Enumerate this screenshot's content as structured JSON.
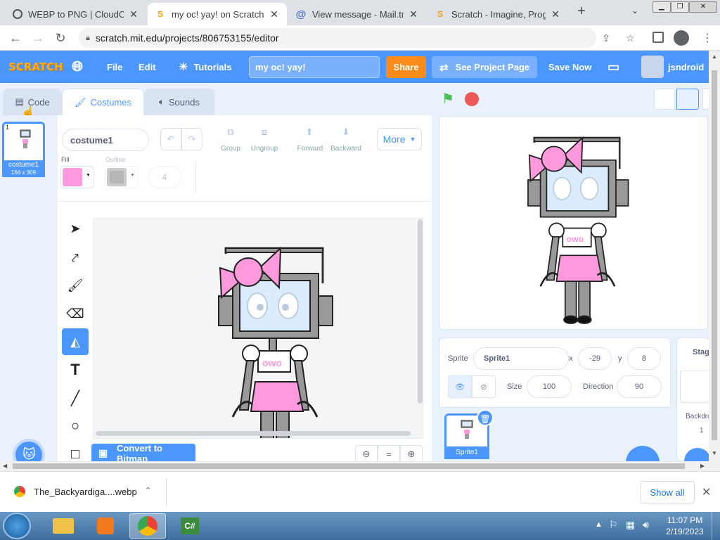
{
  "browser": {
    "tabs": [
      {
        "title": "WEBP to PNG | CloudCon",
        "icon": "cloudconvert-icon",
        "active": false
      },
      {
        "title": "my oc! yay! on Scratch",
        "icon": "scratch-icon",
        "active": true
      },
      {
        "title": "View message - Mail.tm",
        "icon": "mail-icon",
        "active": false
      },
      {
        "title": "Scratch - Imagine, Progra",
        "icon": "scratch-icon",
        "active": false
      }
    ],
    "new_tab": "+",
    "url": "scratch.mit.edu/projects/806753155/editor"
  },
  "menubar": {
    "logo": "SCRATCH",
    "file": "File",
    "edit": "Edit",
    "tutorials": "Tutorials",
    "project_title": "my oc! yay!",
    "share": "Share",
    "see_project": "See Project Page",
    "save_now": "Save Now",
    "username": "jsndroid"
  },
  "editor_tabs": {
    "code": "Code",
    "costumes": "Costumes",
    "sounds": "Sounds"
  },
  "costume_list": [
    {
      "index": "1",
      "name": "costume1",
      "size": "166 x 309"
    }
  ],
  "paint_editor": {
    "costume_name": "costume1",
    "group": "Group",
    "ungroup": "Ungroup",
    "forward": "Forward",
    "backward": "Backward",
    "more": "More",
    "fill_label": "Fill",
    "outline_label": "Outline",
    "outline_width": "4",
    "fill_color": "#ff99dd",
    "convert_button": "Convert to Bitmap",
    "zoom_reset": "="
  },
  "sprite_info": {
    "sprite_label": "Sprite",
    "sprite_name": "Sprite1",
    "x_label": "x",
    "x_value": "-29",
    "y_label": "y",
    "y_value": "8",
    "show_label": "Show",
    "size_label": "Size",
    "size_value": "100",
    "direction_label": "Direction",
    "direction_value": "90"
  },
  "sprites": [
    {
      "name": "Sprite1"
    }
  ],
  "stage_pane": {
    "label": "Stage",
    "backdrops_label": "Backdro",
    "backdrops_count": "1"
  },
  "download": {
    "filename": "The_Backyardiga....webp",
    "show_all": "Show all"
  },
  "taskbar": {
    "time": "11:07 PM",
    "date": "2/19/2023"
  },
  "colors": {
    "scratch_blue": "#4c97ff",
    "share_orange": "#ff8c1a",
    "costume_pink": "#ff99dd"
  }
}
